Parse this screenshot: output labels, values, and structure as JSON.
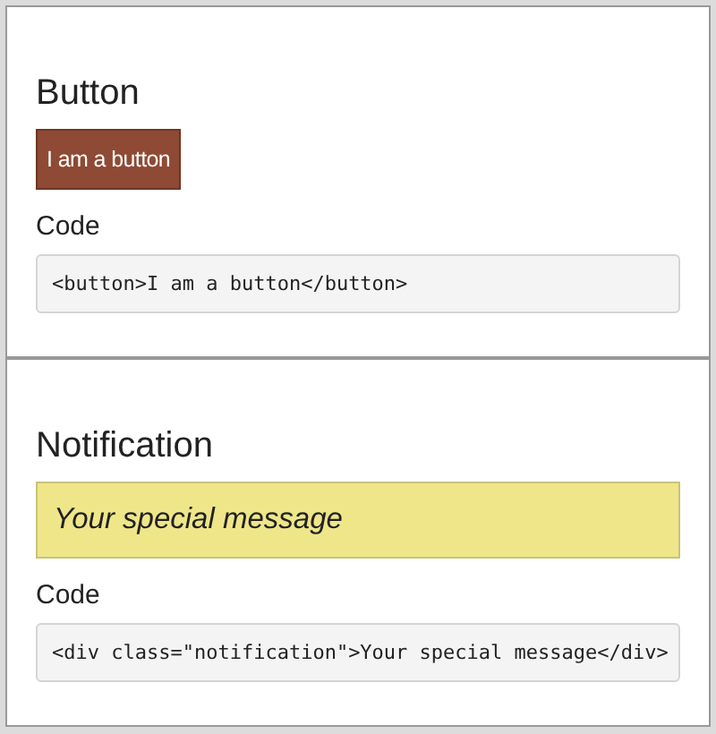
{
  "sections": [
    {
      "heading": "Button",
      "sample": {
        "kind": "button",
        "text": "I am a button"
      },
      "code_label": "Code",
      "code": "<button>I am a button</button>"
    },
    {
      "heading": "Notification",
      "sample": {
        "kind": "notification",
        "text": "Your special message"
      },
      "code_label": "Code",
      "code": "<div class=\"notification\">Your special message</div>"
    }
  ]
}
